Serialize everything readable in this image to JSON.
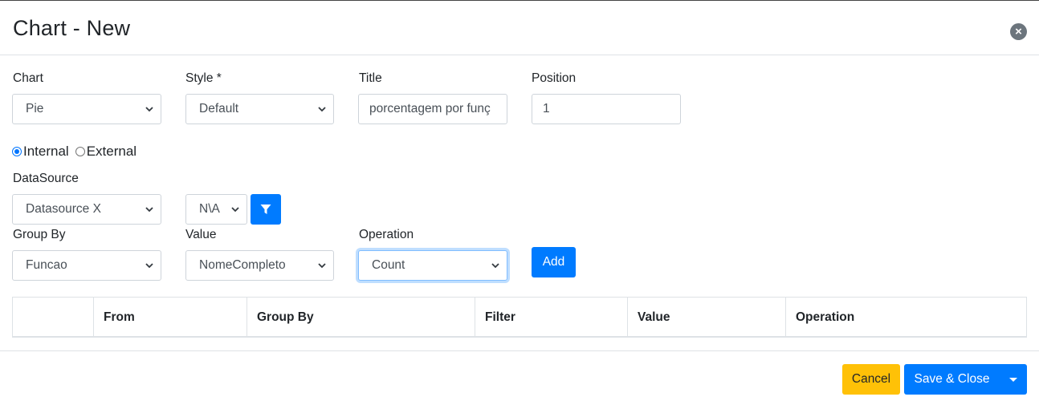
{
  "modal": {
    "title": "Chart - New",
    "close_icon": "close-circle-icon"
  },
  "form": {
    "chart": {
      "label": "Chart",
      "value": "Pie"
    },
    "style": {
      "label": "Style *",
      "value": "Default"
    },
    "title": {
      "label": "Title",
      "value": "porcentagem por funç"
    },
    "position": {
      "label": "Position",
      "value": "1"
    },
    "source_type": {
      "internal": "Internal",
      "external": "External",
      "selected": "Internal"
    },
    "datasource": {
      "label": "DataSource",
      "value": "Datasource X"
    },
    "datasource_filter": {
      "value": "N\\A",
      "filter_icon": "filter-icon"
    },
    "group_by": {
      "label": "Group By",
      "value": "Funcao"
    },
    "value": {
      "label": "Value",
      "value": "NomeCompleto"
    },
    "operation": {
      "label": "Operation",
      "value": "Count"
    },
    "add_label": "Add"
  },
  "table": {
    "columns": [
      "",
      "From",
      "Group By",
      "Filter",
      "Value",
      "Operation"
    ]
  },
  "footer": {
    "cancel_label": "Cancel",
    "save_label": "Save & Close",
    "colors": {
      "primary": "#007bff",
      "warning": "#ffc107"
    }
  }
}
